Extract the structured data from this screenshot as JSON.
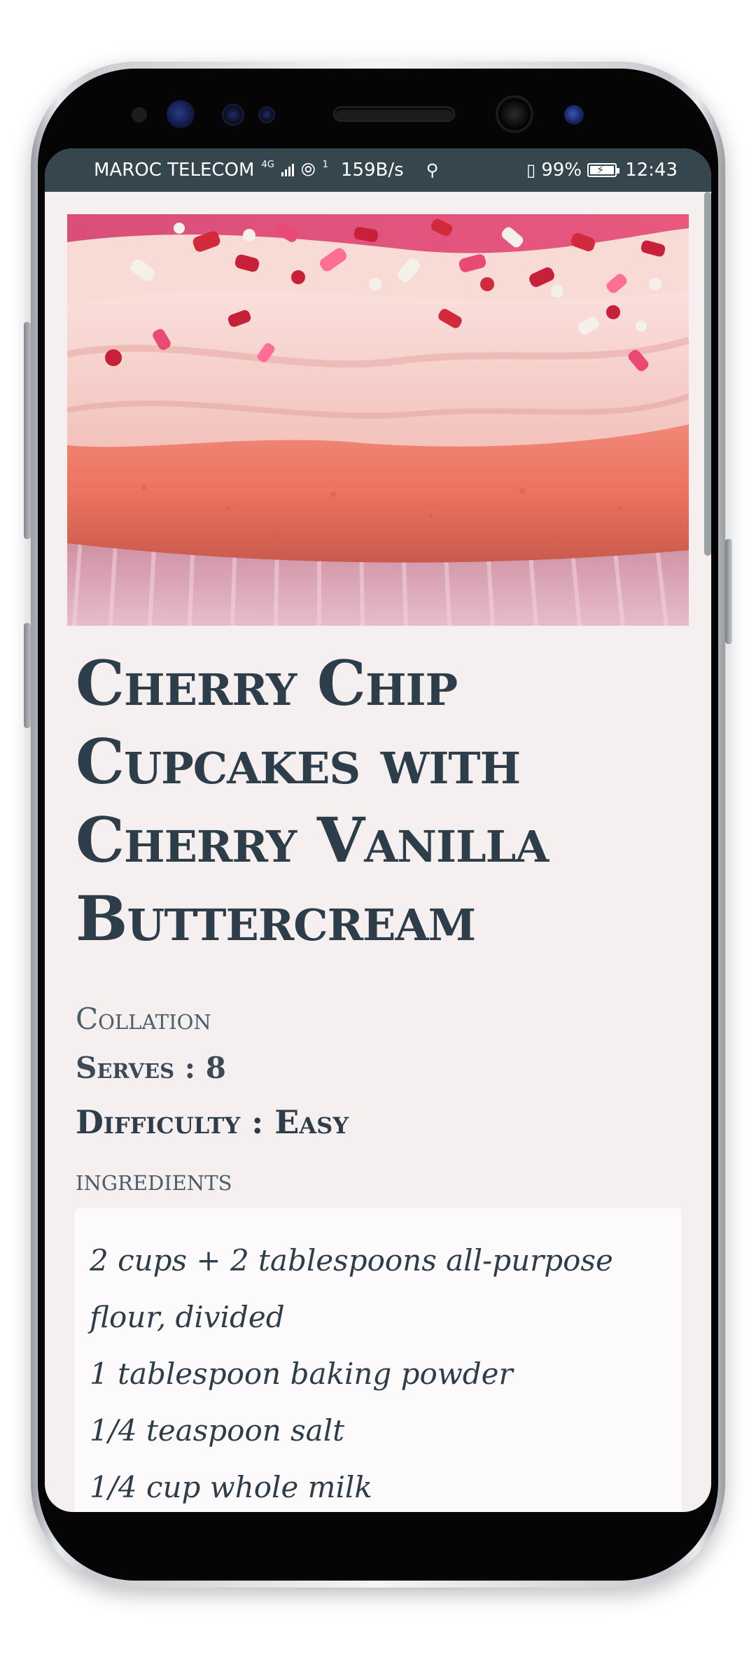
{
  "status_bar": {
    "carrier": "MAROC TELECOM",
    "network": "4G",
    "hotspot_badge": "1",
    "speed": "159B/s",
    "usb_icon": "usb-icon",
    "vibrate_icon": "vibrate-icon",
    "battery": "99%",
    "battery_level": 0.99,
    "time": "12:43"
  },
  "recipe": {
    "title": "Cherry Chip Cupcakes with Cherry Vanilla Buttercream",
    "category": "Collation",
    "serves": "Serves : 8",
    "difficulty": "Difficulty : Easy",
    "ingredients_heading": "ingredients",
    "ingredients": [
      "2 cups + 2 tablespoons all-purpose flour, divided",
      "1 tablespoon baking powder",
      "1/4 teaspoon salt",
      "1/4 cup whole milk"
    ]
  },
  "colors": {
    "status_bar": "#35464f",
    "page_background": "#f5eff0",
    "text_primary": "#2d3d49",
    "card_background": "#fcfafa"
  }
}
